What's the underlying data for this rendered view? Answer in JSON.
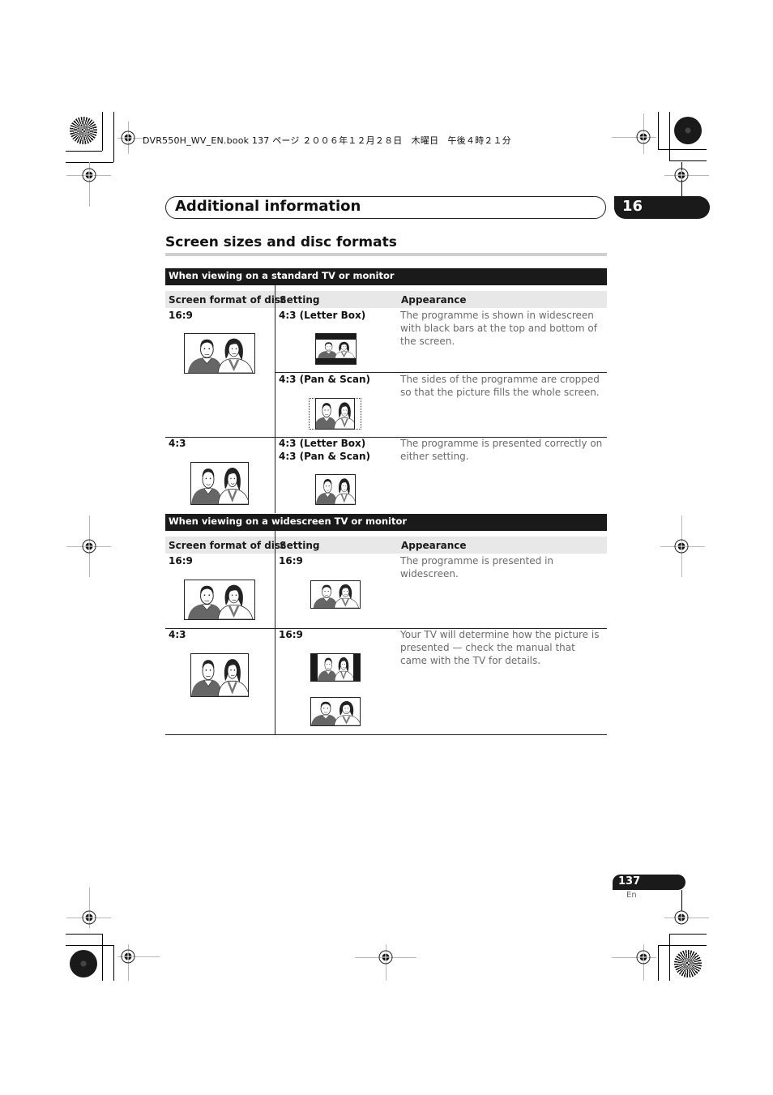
{
  "print_header": {
    "file_info": "DVR550H_WV_EN.book  137 ページ  ２００６年１２月２８日　木曜日　午後４時２１分"
  },
  "chapter": {
    "title": "Additional information",
    "number": "16"
  },
  "section": {
    "title": "Screen sizes and disc formats"
  },
  "tables": [
    {
      "title": "When viewing on a standard TV or monitor",
      "columns": [
        "Screen format of disc",
        "Setting",
        "Appearance"
      ],
      "rows": [
        {
          "disc_format": "16:9",
          "disc_picture": "widescreen-picture",
          "settings": [
            {
              "setting": "4:3 (Letter Box)",
              "picture": "letterbox-picture",
              "appearance": "The programme is shown in widescreen with black bars at the top and bottom of the screen."
            },
            {
              "setting": "4:3 (Pan & Scan)",
              "picture": "pan-scan-picture",
              "appearance": "The sides of the programme are cropped so that the picture fills the whole screen."
            }
          ]
        },
        {
          "disc_format": "4:3",
          "disc_picture": "standard-picture",
          "settings": [
            {
              "setting": "4:3 (Letter Box)",
              "setting_2": "4:3 (Pan & Scan)",
              "picture": "standard-picture",
              "appearance": "The programme is presented correctly on either setting."
            }
          ]
        }
      ]
    },
    {
      "title": "When viewing on a widescreen TV or monitor",
      "columns": [
        "Screen format of disc",
        "Setting",
        "Appearance"
      ],
      "rows": [
        {
          "disc_format": "16:9",
          "disc_picture": "widescreen-picture",
          "settings": [
            {
              "setting": "16:9",
              "picture": "widescreen-picture",
              "appearance": "The programme is presented in widescreen."
            }
          ]
        },
        {
          "disc_format": "4:3",
          "disc_picture": "standard-picture",
          "settings": [
            {
              "setting": "16:9",
              "picture": "pillarbox-picture",
              "picture_2": "stretched-picture",
              "appearance": "Your TV will determine how the picture is presented — check the manual that came with the TV for details."
            }
          ]
        }
      ]
    }
  ],
  "footer": {
    "page_number": "137",
    "language": "En"
  }
}
